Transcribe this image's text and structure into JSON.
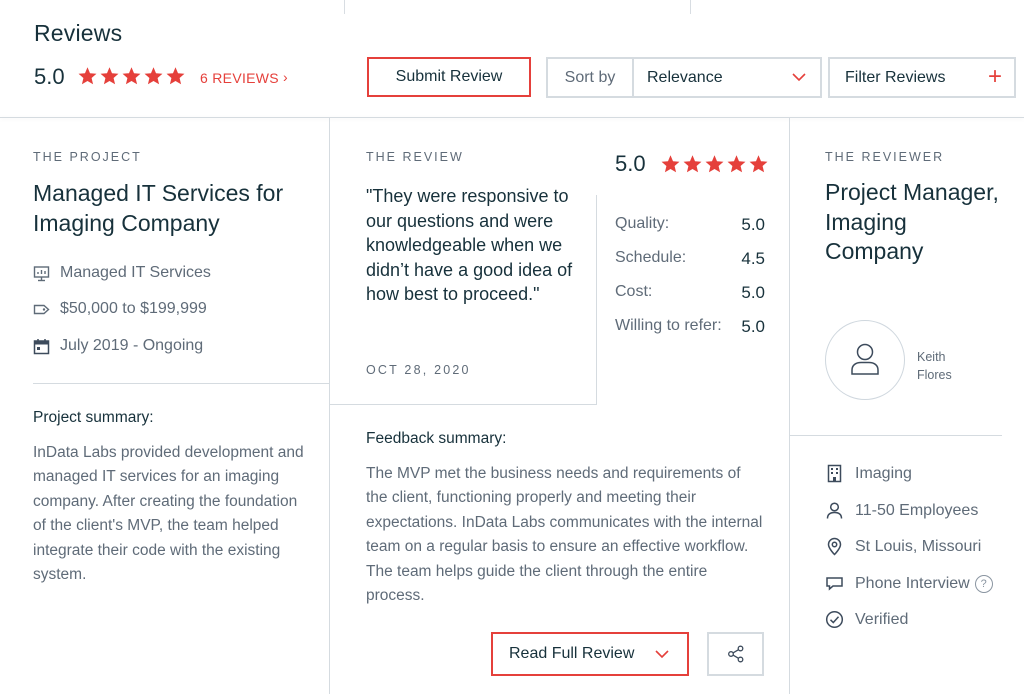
{
  "header": {
    "title": "Reviews",
    "avg_rating": "5.0",
    "star_count": 5,
    "reviews_link": "6 REVIEWS",
    "reviews_chevron": "›",
    "submit_label": "Submit Review",
    "sort_label": "Sort by",
    "sort_value": "Relevance",
    "filter_label": "Filter Reviews",
    "filter_plus": "+"
  },
  "project": {
    "section_label": "THE PROJECT",
    "title": "Managed IT Services for Imaging Company",
    "meta": [
      {
        "icon": "presentation-chart-icon",
        "text": "Managed IT Services"
      },
      {
        "icon": "price-tag-icon",
        "text": "$50,000 to $199,999"
      },
      {
        "icon": "calendar-icon",
        "text": "July 2019 - Ongoing"
      }
    ],
    "summary_heading": "Project summary:",
    "summary_text": "InData Labs provided development and managed IT services for an imaging company. After creating the foundation of the client's MVP, the team helped integrate their code with the existing system."
  },
  "review": {
    "section_label": "THE REVIEW",
    "quote": "\"They were responsive to our questions and were knowledgeable when we didn’t have a good idea of how best to proceed.\"",
    "date": "OCT 28, 2020",
    "overall": "5.0",
    "scores": [
      {
        "label": "Quality:",
        "value": "5.0"
      },
      {
        "label": "Schedule:",
        "value": "4.5"
      },
      {
        "label": "Cost:",
        "value": "5.0"
      },
      {
        "label": "Willing to refer:",
        "value": "5.0"
      }
    ],
    "feedback_heading": "Feedback summary:",
    "feedback_text": "The MVP met the business needs and requirements of the client, functioning properly and meeting their expectations. InData Labs communicates with the internal team on a regular basis to ensure an effective workflow. The team helps guide the client through the entire process.",
    "read_full_label": "Read Full Review"
  },
  "reviewer": {
    "section_label": "THE REVIEWER",
    "title": "Project Manager, Imaging Company",
    "name_first": "Keith",
    "name_last": "Flores",
    "details": [
      {
        "icon": "building-icon",
        "text": "Imaging"
      },
      {
        "icon": "person-icon",
        "text": "11-50 Employees"
      },
      {
        "icon": "location-pin-icon",
        "text": "St Louis, Missouri"
      },
      {
        "icon": "speech-bubble-icon",
        "text": "Phone Interview"
      },
      {
        "icon": "check-circle-icon",
        "text": "Verified"
      }
    ],
    "help_glyph": "?"
  },
  "colors": {
    "accent_red": "#e5403b",
    "heading_navy": "#17313b",
    "body_gray": "#5f6b78",
    "divider": "#d5dbe0"
  }
}
